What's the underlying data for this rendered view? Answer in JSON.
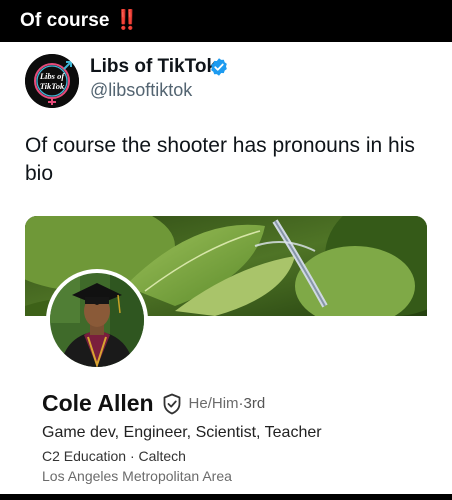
{
  "story": {
    "title": "Of course",
    "emoji": "‼️",
    "accent": "#e0251b"
  },
  "tweet": {
    "author_name": "Libs of TikTok",
    "handle": "@libsoftiktok",
    "avatar_text_line1": "Libs of",
    "avatar_text_line2": "TikTok",
    "verified": true,
    "verified_color": "#1d9bf0",
    "text": "Of course the shooter has pronouns in his bio"
  },
  "profile": {
    "name": "Cole Allen",
    "pronouns": "He/Him",
    "separator": " · ",
    "degree": "3rd",
    "headline": "Game dev, Engineer, Scientist,  Teacher",
    "education": "C2 Education · Caltech",
    "location": "Los Angeles Metropolitan Area",
    "verification_icon": "shield-check-icon"
  }
}
